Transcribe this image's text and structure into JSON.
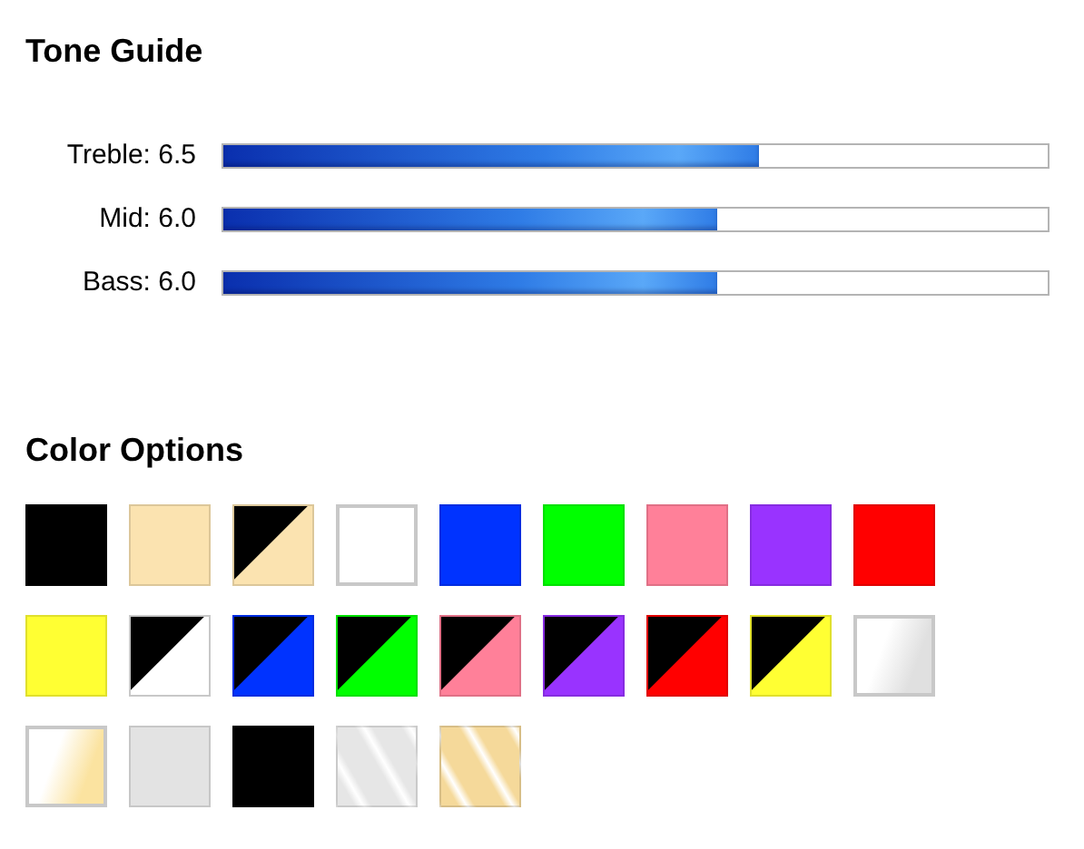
{
  "tone_guide": {
    "title": "Tone Guide",
    "meters": [
      {
        "label": "Treble: 6.5",
        "level": 0.65
      },
      {
        "label": "Mid: 6.0",
        "level": 0.6
      },
      {
        "label": "Bass: 6.0",
        "level": 0.6
      }
    ]
  },
  "color_options": {
    "title": "Color Options",
    "swatches": [
      {
        "kind": "solid",
        "color": "#000000"
      },
      {
        "kind": "solid",
        "color": "#fbe3b0"
      },
      {
        "kind": "split",
        "color": "#fbe3b0"
      },
      {
        "kind": "solid",
        "color": "#ffffff"
      },
      {
        "kind": "solid",
        "color": "#0033ff"
      },
      {
        "kind": "solid",
        "color": "#00ff00"
      },
      {
        "kind": "solid",
        "color": "#ff8099"
      },
      {
        "kind": "solid",
        "color": "#9933ff"
      },
      {
        "kind": "solid",
        "color": "#ff0000"
      },
      {
        "kind": "solid",
        "color": "#ffff33"
      },
      {
        "kind": "split",
        "color": "#ffffff"
      },
      {
        "kind": "split",
        "color": "#0033ff"
      },
      {
        "kind": "split",
        "color": "#00ff00"
      },
      {
        "kind": "split",
        "color": "#ff8099"
      },
      {
        "kind": "split",
        "color": "#9933ff"
      },
      {
        "kind": "split",
        "color": "#ff0000"
      },
      {
        "kind": "split",
        "color": "#ffff33"
      },
      {
        "kind": "fade",
        "color": "#e0e0e0"
      },
      {
        "kind": "fade",
        "color": "#fbe3a0"
      },
      {
        "kind": "solid",
        "color": "#e3e3e3"
      },
      {
        "kind": "solid",
        "color": "#000000"
      },
      {
        "kind": "stripes",
        "color": "#e6e6e6"
      },
      {
        "kind": "stripes",
        "color": "#f5d99a"
      }
    ]
  }
}
